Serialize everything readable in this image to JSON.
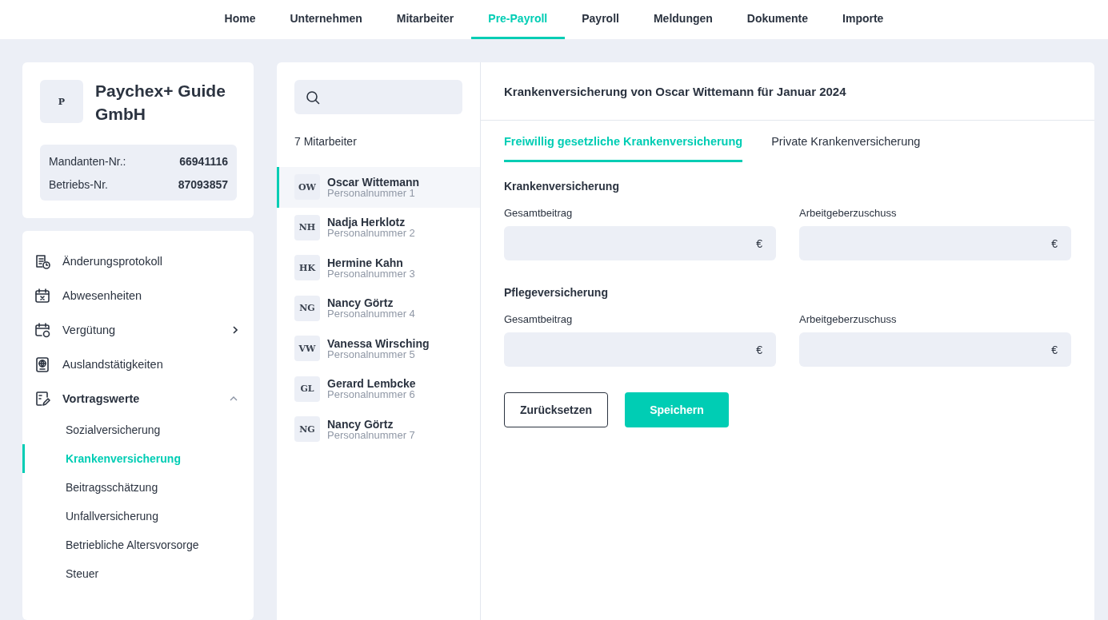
{
  "nav": [
    {
      "label": "Home",
      "selected": false
    },
    {
      "label": "Unternehmen",
      "selected": false
    },
    {
      "label": "Mitarbeiter",
      "selected": false
    },
    {
      "label": "Pre-Payroll",
      "selected": true
    },
    {
      "label": "Payroll",
      "selected": false
    },
    {
      "label": "Meldungen",
      "selected": false
    },
    {
      "label": "Dokumente",
      "selected": false
    },
    {
      "label": "Importe",
      "selected": false
    }
  ],
  "company": {
    "logo": "P",
    "name": "Paychex+ Guide GmbH",
    "details": [
      {
        "label": "Mandanten-Nr.:",
        "value": "66941116"
      },
      {
        "label": "Betriebs-Nr.",
        "value": "87093857"
      }
    ]
  },
  "sidebar": {
    "items": [
      {
        "label": "Änderungsprotokoll"
      },
      {
        "label": "Abwesenheiten"
      },
      {
        "label": "Vergütung",
        "expanded": false
      },
      {
        "label": "Auslandstätigkeiten"
      },
      {
        "label": "Vortragswerte",
        "expanded": true,
        "children": [
          {
            "label": "Sozialversicherung",
            "selected": false
          },
          {
            "label": "Krankenversicherung",
            "selected": true
          },
          {
            "label": "Beitragsschätzung",
            "selected": false
          },
          {
            "label": "Unfallversicherung",
            "selected": false
          },
          {
            "label": "Betriebliche Altersvorsorge",
            "selected": false
          },
          {
            "label": "Steuer",
            "selected": false
          }
        ]
      }
    ]
  },
  "employees": {
    "count": "7 Mitarbeiter",
    "items": [
      {
        "initials": "OW",
        "name": "Oscar Wittemann",
        "number": "Personalnummer 1",
        "selected": true
      },
      {
        "initials": "NH",
        "name": "Nadja Herklotz",
        "number": "Personalnummer 2",
        "selected": false
      },
      {
        "initials": "HK",
        "name": "Hermine Kahn",
        "number": "Personalnummer 3",
        "selected": false
      },
      {
        "initials": "NG",
        "name": "Nancy Görtz",
        "number": "Personalnummer 4",
        "selected": false
      },
      {
        "initials": "VW",
        "name": "Vanessa Wirsching",
        "number": "Personalnummer 5",
        "selected": false
      },
      {
        "initials": "GL",
        "name": "Gerard Lembcke",
        "number": "Personalnummer 6",
        "selected": false
      },
      {
        "initials": "NG",
        "name": "Nancy Görtz",
        "number": "Personalnummer 7",
        "selected": false
      }
    ]
  },
  "detail": {
    "title": "Krankenversicherung von Oscar Wittemann für Januar 2024",
    "tabs": [
      {
        "label": "Freiwillig gesetzliche Krankenversicherung",
        "selected": true
      },
      {
        "label": "Private Krankenversicherung",
        "selected": false
      }
    ],
    "sections": [
      {
        "title": "Krankenversicherung",
        "fields": [
          {
            "label": "Gesamtbeitrag",
            "unit": "€"
          },
          {
            "label": "Arbeitgeberzuschuss",
            "unit": "€"
          }
        ]
      },
      {
        "title": "Pflegeversicherung",
        "fields": [
          {
            "label": "Gesamtbeitrag",
            "unit": "€"
          },
          {
            "label": "Arbeitgeberzuschuss",
            "unit": "€"
          }
        ]
      }
    ],
    "buttons": [
      {
        "label": "Zurücksetzen",
        "kind": "secondary"
      },
      {
        "label": "Speichern",
        "kind": "primary"
      }
    ]
  }
}
